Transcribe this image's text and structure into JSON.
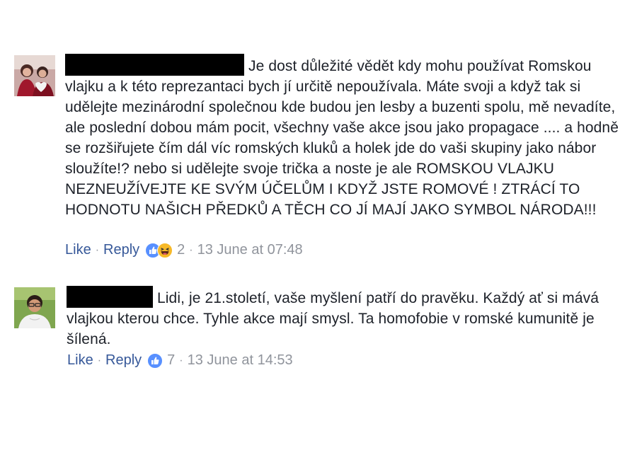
{
  "comments": [
    {
      "text": "Je dost důležité vědět kdy mohu používat Romskou vlajku a k této reprezantaci bych jí určitě nepoužívala. Máte svoji a když tak si udělejte mezinárodní společnou kde budou jen lesby a buzenti spolu, mě nevadíte, ale poslední dobou mám pocit, všechny vaše akce jsou jako propagace .... a hodně se rozšiřujete čím dál víc romských kluků a holek jde do vaši skupiny jako nábor sloužíte!? nebo si udělejte svoje trička a noste je ale ROMSKOU VLAJKU NEZNEUŽÍVEJTE KE SVÝM ÚČELŮM I KDYŽ JSTE ROMOVÉ ! ZTRÁCÍ TO HODNOTU NAŠICH PŘEDKŮ A TĚCH CO JÍ MAJÍ JAKO SYMBOL NÁRODA!!!",
      "like_label": "Like",
      "reply_label": "Reply",
      "separator": "·",
      "reactions": [
        "like-icon",
        "haha-icon"
      ],
      "reaction_count": "2",
      "timestamp": "13 June at 07:48"
    },
    {
      "text": "Lidi, je 21.století, vaše myšlení patří do pravěku. Každý ať si mává vlajkou kterou chce. Tyhle akce mají smysl. Ta homofobie v romské kumunitě je šílená.",
      "like_label": "Like",
      "reply_label": "Reply",
      "separator": "·",
      "reactions": [
        "like-icon"
      ],
      "reaction_count": "7",
      "timestamp": "13 June at 14:53"
    }
  ],
  "colors": {
    "link": "#365899",
    "meta": "#90949c",
    "text": "#1d2129",
    "like_blue": "#5890ff",
    "haha_yellow": "#f7b928"
  }
}
